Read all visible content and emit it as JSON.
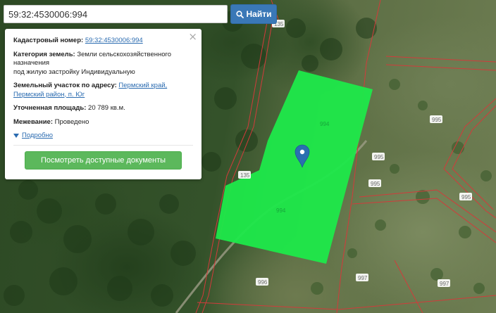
{
  "search": {
    "value": "59:32:4530006:994",
    "button_label": "Найти"
  },
  "info": {
    "cadastral_label": "Кадастровый номер:",
    "cadastral_value": "59:32:4530006:994",
    "category_label": "Категория земель:",
    "category_value_line1": "Земли сельскохозяйственного",
    "category_value_line2": "назначения",
    "category_value_line3": "под жилую застройку Индивидуальную",
    "address_label": "Земельный участок по адресу:",
    "address_value_line1": "Пермский край,",
    "address_value_line2": "Пермский район, п. Юг",
    "area_label": "Уточненная площадь:",
    "area_value": "20 789 кв.м.",
    "survey_label": "Межевание:",
    "survey_value": "Проведено",
    "more_label": "Подробно",
    "docs_button": "Посмотреть доступные документы",
    "close_symbol": "×"
  },
  "map": {
    "selected_parcel_color": "#1ee94a",
    "boundary_color": "#d23b3b",
    "marker_color": "#2a6fb0",
    "parcel_labels": {
      "p994a": "994",
      "p994b": "994",
      "p135a": "135",
      "p135b": "135",
      "p995a": "995",
      "p995b": "995",
      "p995c": "995",
      "p995d": "995",
      "p996": "996",
      "p997a": "997",
      "p997b": "997"
    }
  },
  "icons": {
    "search": "search-icon",
    "close": "close-icon",
    "marker": "map-marker-icon",
    "expand": "triangle-down-icon"
  }
}
